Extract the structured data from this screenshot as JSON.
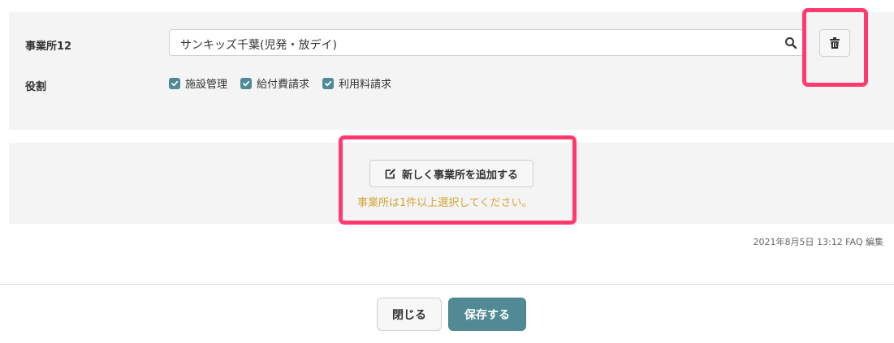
{
  "office": {
    "label": "事業所12",
    "selected_value": "サンキッズ千葉(児発・放デイ)",
    "search_icon": "search-icon",
    "delete_icon": "trash-icon"
  },
  "roles": {
    "label": "役割",
    "items": [
      {
        "label": "施設管理",
        "checked": true
      },
      {
        "label": "給付費請求",
        "checked": true
      },
      {
        "label": "利用料請求",
        "checked": true
      }
    ]
  },
  "add_office": {
    "button_label": "新しく事業所を追加する",
    "icon": "edit-icon",
    "warning": "事業所は1件以上選択してください。"
  },
  "meta": {
    "updated": "2021年8月5日 13:12 FAQ 編集"
  },
  "footer": {
    "close_label": "閉じる",
    "save_label": "保存する"
  },
  "colors": {
    "accent": "#518a95",
    "highlight": "#ff3a6e",
    "warning": "#d4a43a"
  }
}
